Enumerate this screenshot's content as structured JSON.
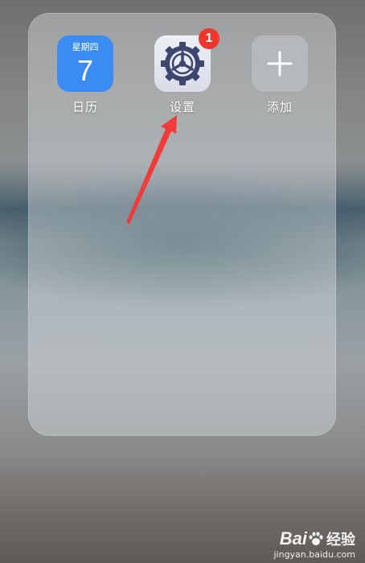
{
  "folder": {
    "apps": [
      {
        "label": "日历",
        "icon": "calendar-icon",
        "weekday": "星期四",
        "day": "7",
        "color": "#3b8cf2"
      },
      {
        "label": "设置",
        "icon": "gear-icon",
        "badge": "1",
        "badge_color": "#f0352b"
      },
      {
        "label": "添加",
        "icon": "plus-icon"
      }
    ]
  },
  "annotation": {
    "icon": "arrow-icon",
    "color": "#f23a3a"
  },
  "watermark": {
    "brand_left": "Bai",
    "brand_right": "经验",
    "url": "jingyan.baidu.com"
  }
}
